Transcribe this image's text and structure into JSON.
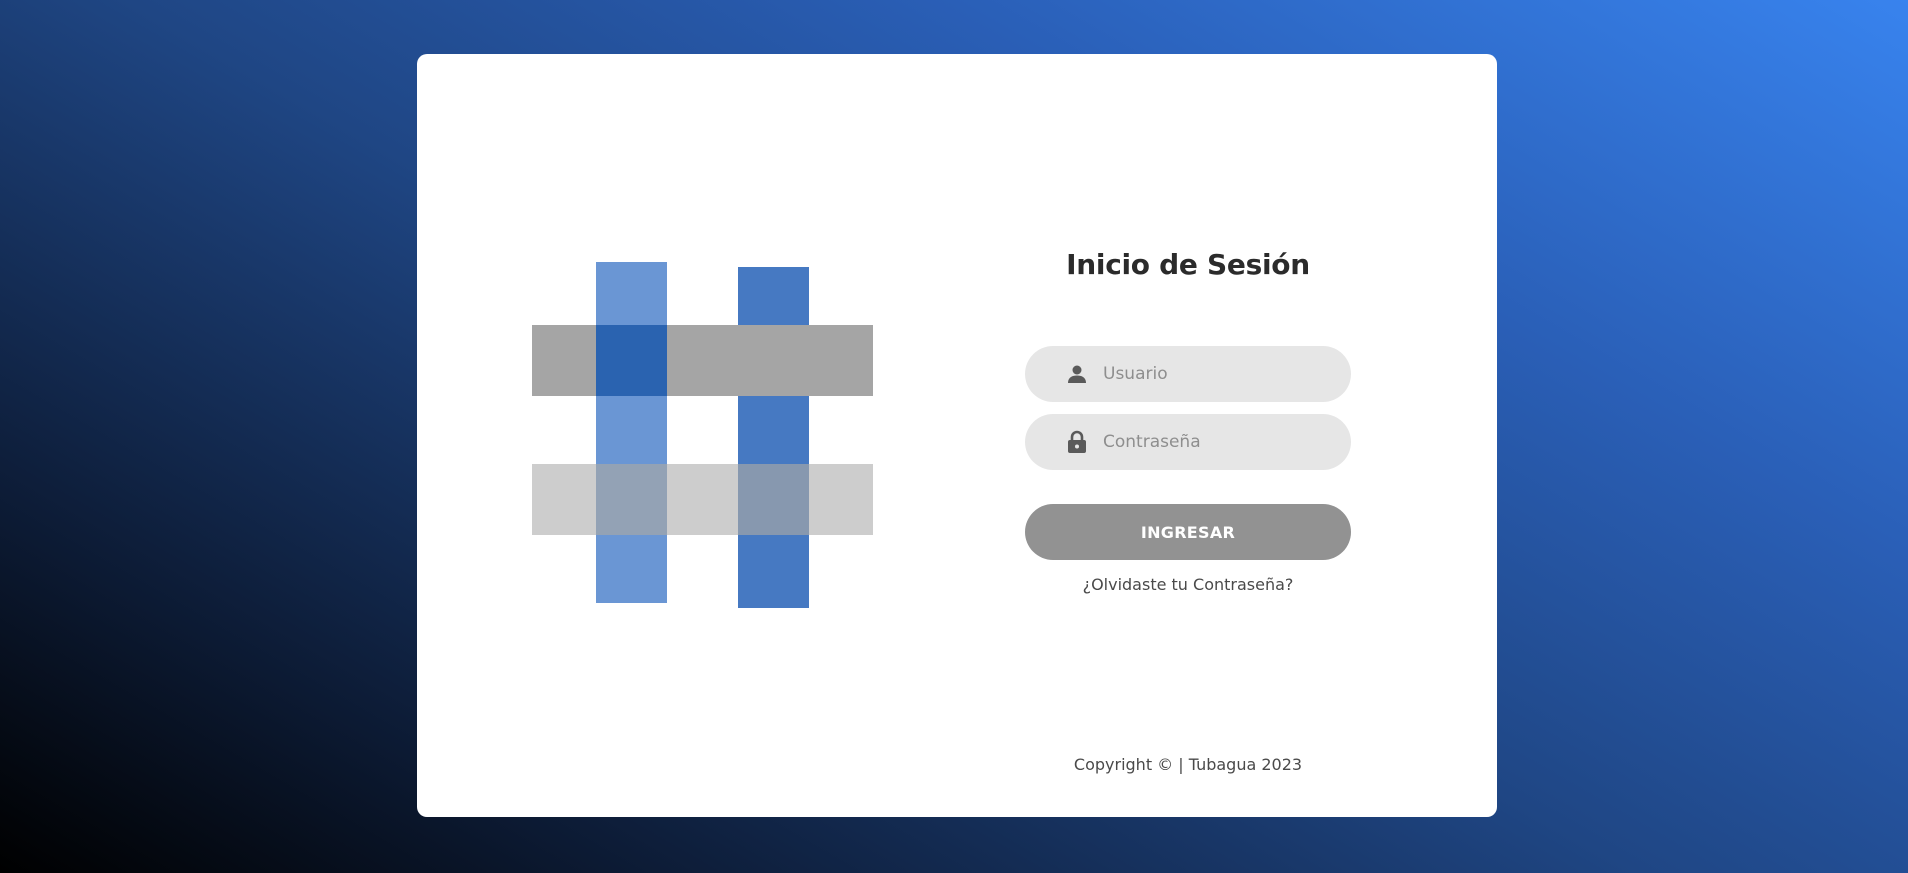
{
  "login": {
    "title": "Inicio de Sesión",
    "username_placeholder": "Usuario",
    "password_placeholder": "Contraseña",
    "submit_label": "INGRESAR",
    "forgot_label": "¿Olvidaste tu Contraseña?"
  },
  "footer": {
    "copyright": "Copyright © | Tubagua 2023"
  },
  "icons": {
    "user": "user-icon",
    "password": "lock-icon",
    "logo": "hash-logo"
  },
  "colors": {
    "background_start": "#000000",
    "background_end": "#3883ee",
    "card": "#ffffff",
    "input_bg": "#e6e6e6",
    "button_bg": "#929292",
    "logo_blue_light": "#6a96d4",
    "logo_blue": "#4679c2",
    "logo_gray": "#a5a5a5",
    "logo_gray_light": "#cdcdcd"
  }
}
